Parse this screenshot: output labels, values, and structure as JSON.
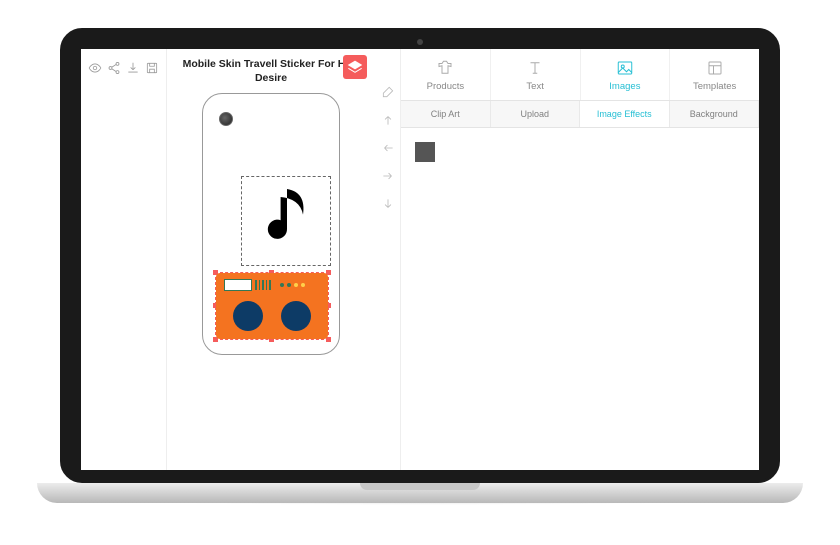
{
  "title": "Mobile Skin Travell Sticker For HTC Desire",
  "mainTabs": {
    "products": "Products",
    "text": "Text",
    "images": "Images",
    "templates": "Templates",
    "active": "Images"
  },
  "subTabs": {
    "clipart": "Clip Art",
    "upload": "Upload",
    "effects": "Image Effects",
    "background": "Background",
    "active": "Image Effects"
  },
  "effects": {
    "color": "#555555"
  }
}
